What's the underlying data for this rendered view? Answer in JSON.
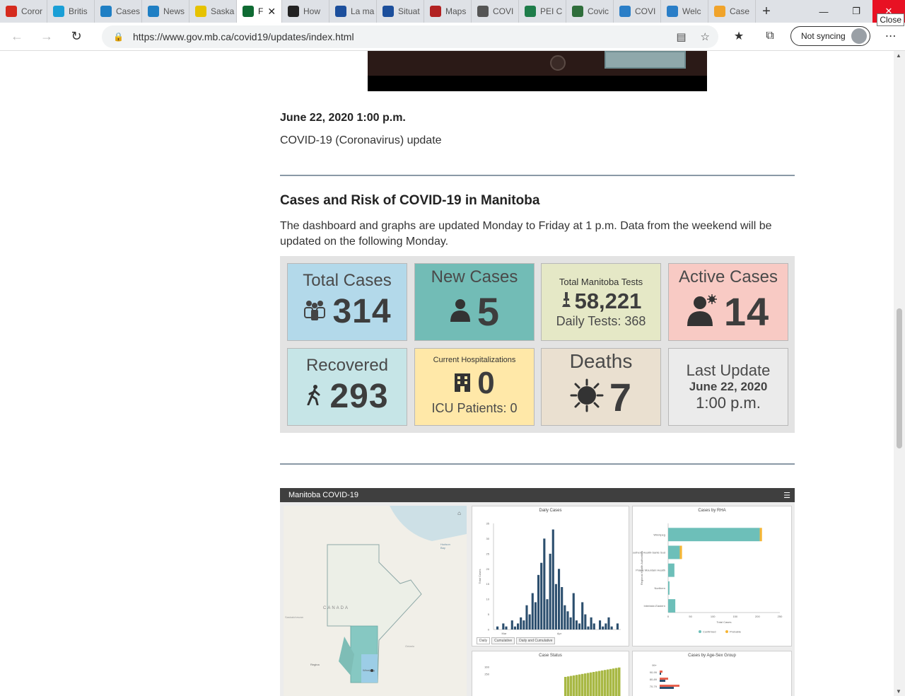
{
  "browser": {
    "tabs": [
      {
        "label": "Coror",
        "color": "#d52b1e",
        "icon": "maple-leaf-icon"
      },
      {
        "label": "Britis",
        "color": "#1a9fd6",
        "icon": "bc-icon"
      },
      {
        "label": "Cases",
        "color": "#1f7fc4",
        "icon": "ab-icon"
      },
      {
        "label": "News",
        "color": "#1f7fc4",
        "icon": "ab-icon"
      },
      {
        "label": "Saska",
        "color": "#e6c200",
        "icon": "sk-icon"
      },
      {
        "label": "F",
        "color": "#0f6b33",
        "icon": "mb-icon"
      },
      {
        "label": "How",
        "color": "#222222",
        "icon": "shield-icon"
      },
      {
        "label": "La ma",
        "color": "#1c4f9c",
        "icon": "qc-icon"
      },
      {
        "label": "Situat",
        "color": "#1c4f9c",
        "icon": "qc-icon"
      },
      {
        "label": "Maps",
        "color": "#b22222",
        "icon": "map-icon"
      },
      {
        "label": "COVI",
        "color": "#555555",
        "icon": "nb-icon"
      },
      {
        "label": "PEI C",
        "color": "#1e7d4a",
        "icon": "pei-icon"
      },
      {
        "label": "Covic",
        "color": "#2f6e3b",
        "icon": "ns-icon"
      },
      {
        "label": "COVI",
        "color": "#2a7ec7",
        "icon": "nl-icon"
      },
      {
        "label": "Welc",
        "color": "#2a7ec7",
        "icon": "yt-icon"
      },
      {
        "label": "Case",
        "color": "#f0a32a",
        "icon": "nwt-icon"
      }
    ],
    "active_tab_index": 5,
    "close_tooltip": "Close",
    "url": "https://www.gov.mb.ca/covid19/updates/index.html",
    "sync_label": "Not syncing"
  },
  "page": {
    "date": "June 22, 2020 1:00 p.m.",
    "subtitle": "COVID-19 (Coronavirus) update",
    "heading": "Cases and Risk of COVID-19 in Manitoba",
    "paragraph": "The dashboard and graphs are updated Monday to Friday at 1 p.m. Data from the weekend will be updated on the following Monday."
  },
  "cards": {
    "total": {
      "label": "Total Cases",
      "value": "314",
      "bg": "#b3d9ea"
    },
    "new": {
      "label": "New Cases",
      "value": "5",
      "bg": "#72bcb6"
    },
    "tests": {
      "label": "Total Manitoba Tests",
      "value": "58,221",
      "daily": "Daily Tests: 368",
      "bg": "#e5e8c6"
    },
    "active": {
      "label": "Active Cases",
      "value": "14",
      "bg": "#f8cac4"
    },
    "recovered": {
      "label": "Recovered",
      "value": "293",
      "bg": "#c6e5e7"
    },
    "hosp": {
      "label": "Current Hospitalizations",
      "value": "0",
      "icu": "ICU Patients: 0",
      "bg": "#ffe8a8"
    },
    "deaths": {
      "label": "Deaths",
      "value": "7",
      "bg": "#eae0d0"
    },
    "last": {
      "label": "Last Update",
      "date": "June 22, 2020",
      "time": "1:00 p.m.",
      "bg": "#ebebeb"
    }
  },
  "embed": {
    "title": "Manitoba COVID-19",
    "map_labels": {
      "canada": "CANADA",
      "bay": "Hudson Bay",
      "regina": "Regina",
      "winnipeg": "Winnipeg",
      "sask": "Saskatchewan",
      "ontario": "Ontario"
    },
    "tabs": [
      "Daily",
      "Cumulative",
      "Daily and Cumulative"
    ],
    "panel_titles": {
      "daily": "Daily Cases",
      "rha": "Cases by RHA",
      "status": "Case Status",
      "agesex": "Cases by Age-Sex Group"
    }
  },
  "chart_data": [
    {
      "type": "bar",
      "title": "Daily Cases",
      "ylabel": "Total Cases",
      "xlabel": "",
      "ylim": [
        0,
        35
      ],
      "yticks": [
        0,
        5,
        10,
        15,
        20,
        25,
        30,
        35
      ],
      "xticks": [
        "Mar",
        "Apr"
      ],
      "values": [
        1,
        0,
        2,
        1,
        0,
        3,
        1,
        2,
        4,
        3,
        8,
        5,
        12,
        9,
        18,
        22,
        30,
        10,
        25,
        33,
        15,
        20,
        14,
        8,
        6,
        4,
        12,
        3,
        2,
        9,
        5,
        1,
        4,
        2,
        0,
        3,
        1,
        2,
        4,
        1,
        0,
        2
      ]
    },
    {
      "type": "bar",
      "title": "Cases by RHA",
      "ylabel": "Regional Health Authorities",
      "xlabel": "Total Cases",
      "xlim": [
        0,
        250
      ],
      "xticks": [
        0,
        50,
        100,
        150,
        200,
        250
      ],
      "categories": [
        "Winnipeg",
        "Southern Health-Santé Sud",
        "Prairie Mountain Health",
        "Northern",
        "Interlake-Eastern"
      ],
      "series": [
        {
          "name": "Confirmed",
          "color": "#6dbfb9",
          "values": [
            205,
            26,
            14,
            3,
            16
          ]
        },
        {
          "name": "Probable",
          "color": "#f6b533",
          "values": [
            5,
            5,
            0,
            0,
            0
          ]
        }
      ]
    }
  ],
  "case_status": {
    "title": "Case Status",
    "ylim": [
      0,
      300
    ],
    "yticks": [
      250,
      300
    ]
  },
  "agesex": {
    "title": "Cases by Age-Sex Group",
    "groups": [
      "99+",
      "90-99",
      "80-89",
      "70-79"
    ]
  }
}
